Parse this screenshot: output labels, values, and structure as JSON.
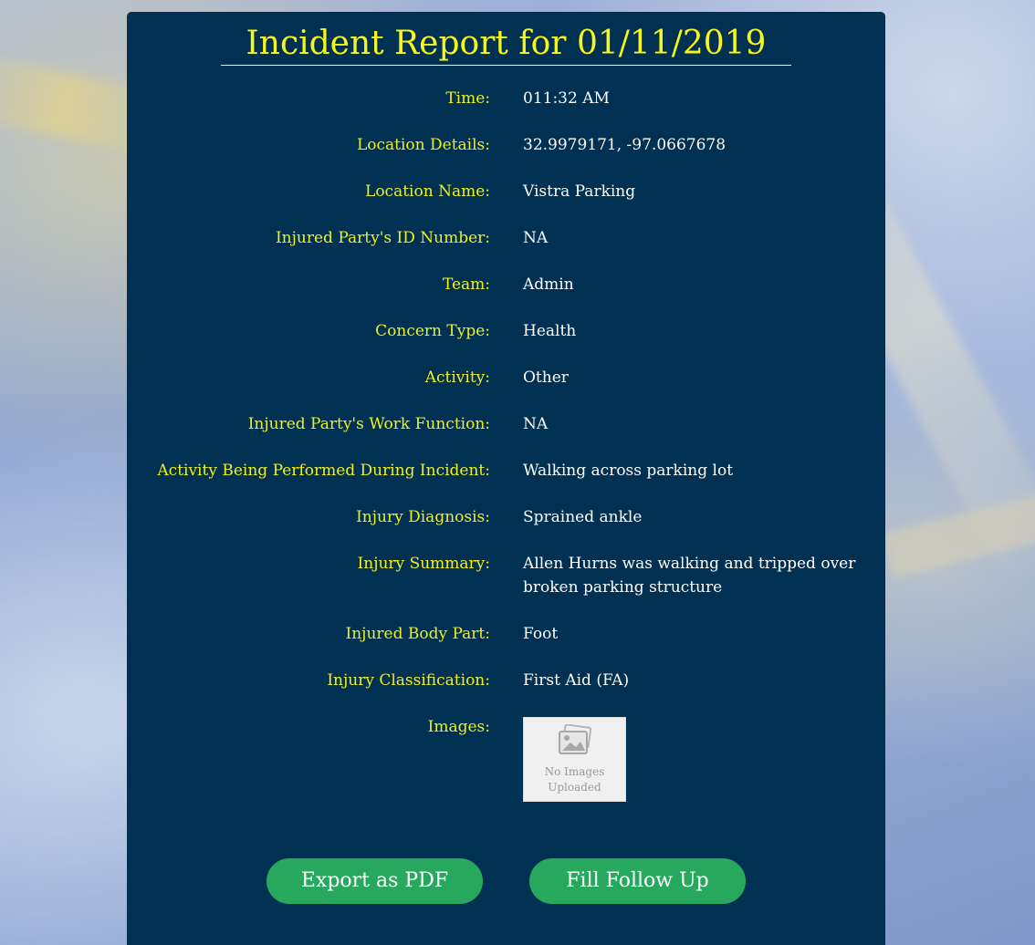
{
  "report": {
    "title": "Incident Report for 01/11/2019"
  },
  "fields": [
    {
      "label": "Time:",
      "value": "011:32 AM"
    },
    {
      "label": "Location Details:",
      "value": "32.9979171, -97.0667678"
    },
    {
      "label": "Location Name:",
      "value": "Vistra Parking"
    },
    {
      "label": "Injured Party's ID Number:",
      "value": "NA"
    },
    {
      "label": "Team:",
      "value": "Admin"
    },
    {
      "label": "Concern Type:",
      "value": "Health"
    },
    {
      "label": "Activity:",
      "value": "Other"
    },
    {
      "label": "Injured Party's Work Function:",
      "value": "NA"
    },
    {
      "label": "Activity Being Performed During Incident:",
      "value": "Walking across parking lot"
    },
    {
      "label": "Injury Diagnosis:",
      "value": "Sprained ankle"
    },
    {
      "label": "Injury Summary:",
      "value": "Allen Hurns was walking and tripped over broken parking structure"
    },
    {
      "label": "Injured Body Part:",
      "value": "Foot"
    },
    {
      "label": "Injury Classification:",
      "value": "First Aid (FA)"
    }
  ],
  "images": {
    "label": "Images:",
    "placeholder_icon": "image-placeholder-icon",
    "placeholder_text": "No Images Uploaded"
  },
  "actions": {
    "export_label": "Export as PDF",
    "follow_up_label": "Fill Follow Up"
  },
  "colors": {
    "card_background": "#003052",
    "label": "#f0f020",
    "title": "#f7f719",
    "value": "#ffffff",
    "button": "#27a85e"
  }
}
